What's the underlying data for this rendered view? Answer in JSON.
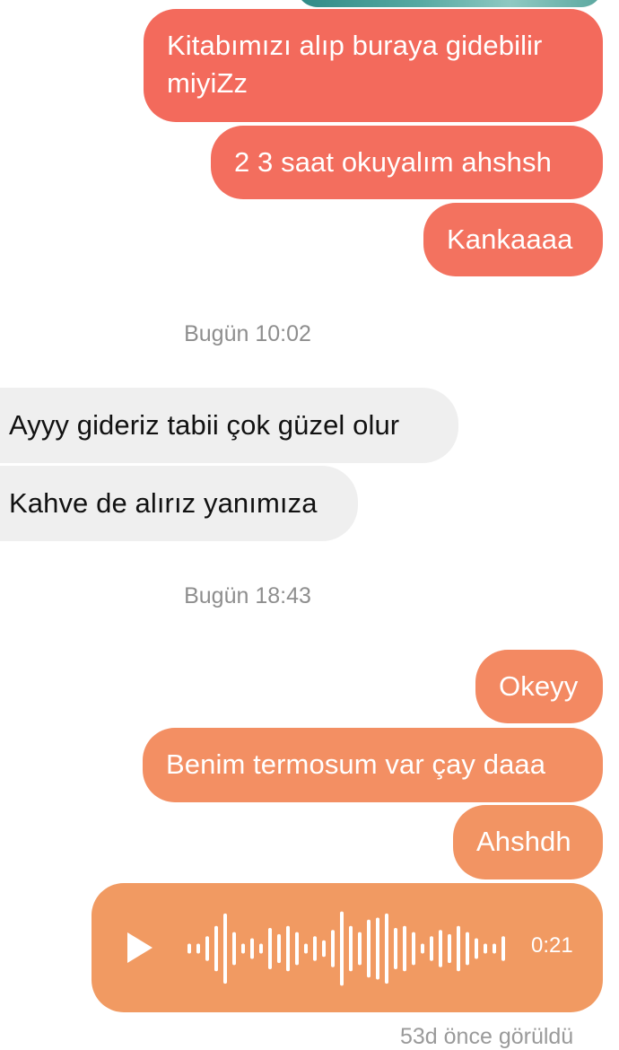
{
  "colors": {
    "out_top": "#f36a5c",
    "out_mid": "#f37c63",
    "out_low": "#f19464",
    "incoming": "#efefef",
    "timestamp": "#8e8e8e"
  },
  "messages_top": [
    {
      "text": "Kitabımızı alıp buraya gidebilir miyiZz"
    },
    {
      "text": "2 3 saat okuyalım ahshsh"
    },
    {
      "text": "Kankaaaa"
    }
  ],
  "timestamp_1": "Bugün 10:02",
  "messages_incoming": [
    {
      "text": "Ayyy gideriz tabii çok güzel olur"
    },
    {
      "text": "Kahve de alırız yanımıza"
    }
  ],
  "timestamp_2": "Bugün 18:43",
  "messages_bottom": [
    {
      "text": "Okeyy"
    },
    {
      "text": "Benim termosum var çay daaa"
    },
    {
      "text": "Ahshdh"
    }
  ],
  "voice_message": {
    "duration": "0:21",
    "play_icon": "play-icon",
    "waveform": [
      0.12,
      0.12,
      0.3,
      0.55,
      0.85,
      0.4,
      0.12,
      0.25,
      0.12,
      0.5,
      0.35,
      0.55,
      0.4,
      0.12,
      0.3,
      0.2,
      0.45,
      0.9,
      0.55,
      0.4,
      0.7,
      0.75,
      0.85,
      0.5,
      0.55,
      0.4,
      0.12,
      0.3,
      0.45,
      0.35,
      0.55,
      0.4,
      0.25,
      0.12,
      0.12,
      0.3
    ]
  },
  "seen_status": "53d önce görüldü"
}
